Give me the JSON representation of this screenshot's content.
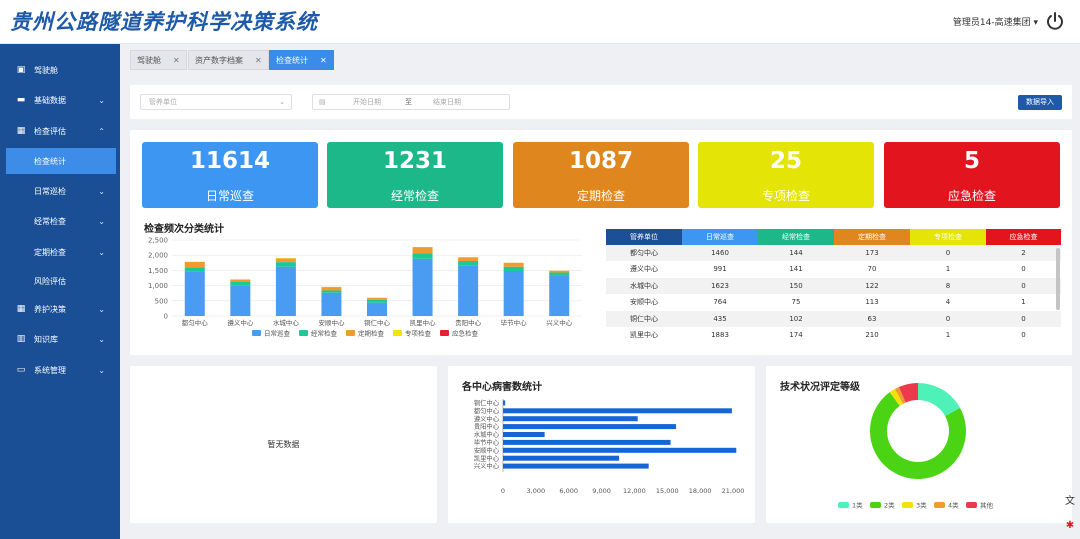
{
  "header": {
    "title": "贵州公路隧道养护科学决策系统",
    "user": "管理员14-高速集团 ▾"
  },
  "sidebar": {
    "items": [
      {
        "label": "驾驶舱",
        "icon": "dashboard-icon",
        "chev": ""
      },
      {
        "label": "基础数据",
        "icon": "database-icon",
        "chev": "⌄"
      },
      {
        "label": "检查评估",
        "icon": "grid-icon",
        "chev": "⌃"
      },
      {
        "label": "检查统计",
        "icon": "",
        "chev": ""
      },
      {
        "label": "日常巡检",
        "icon": "",
        "chev": "⌄"
      },
      {
        "label": "经常检查",
        "icon": "",
        "chev": "⌄"
      },
      {
        "label": "定期检查",
        "icon": "",
        "chev": "⌄"
      },
      {
        "label": "风险评估",
        "icon": "",
        "chev": ""
      },
      {
        "label": "养护决策",
        "icon": "grid-icon",
        "chev": "⌄"
      },
      {
        "label": "知识库",
        "icon": "book-icon",
        "chev": "⌄"
      },
      {
        "label": "系统管理",
        "icon": "monitor-icon",
        "chev": "⌄"
      }
    ]
  },
  "tabs": [
    {
      "label": "驾驶舱",
      "close": "✕"
    },
    {
      "label": "资产数字档案",
      "close": "✕"
    },
    {
      "label": "检查统计",
      "close": "✕"
    }
  ],
  "filter": {
    "unit_placeholder": "管养单位",
    "start_placeholder": "开始日期",
    "end_placeholder": "结束日期",
    "sep": "至",
    "import_label": "数据导入"
  },
  "stats": [
    {
      "value": "11614",
      "label": "日常巡查",
      "color": "#3d97f2"
    },
    {
      "value": "1231",
      "label": "经常检查",
      "color": "#1cb88a"
    },
    {
      "value": "1087",
      "label": "定期检查",
      "color": "#e0861f"
    },
    {
      "value": "25",
      "label": "专项检查",
      "color": "#e4e407"
    },
    {
      "value": "5",
      "label": "应急检查",
      "color": "#e2151f"
    }
  ],
  "freq_chart_title": "检查频次分类统计",
  "table": {
    "headers": [
      "管养单位",
      "日常巡查",
      "经常检查",
      "定期检查",
      "专项检查",
      "应急检查"
    ],
    "header_colors": [
      "#1d4f96",
      "#3d97f2",
      "#1cb88a",
      "#e0861f",
      "#e4e407",
      "#e2151f"
    ],
    "rows": [
      [
        "都匀中心",
        "1460",
        "144",
        "173",
        "0",
        "2"
      ],
      [
        "遵义中心",
        "991",
        "141",
        "70",
        "1",
        "0"
      ],
      [
        "水城中心",
        "1623",
        "150",
        "122",
        "8",
        "0"
      ],
      [
        "安顺中心",
        "764",
        "75",
        "113",
        "4",
        "1"
      ],
      [
        "铜仁中心",
        "435",
        "102",
        "63",
        "0",
        "0"
      ],
      [
        "凯里中心",
        "1883",
        "174",
        "210",
        "1",
        "0"
      ]
    ]
  },
  "no_data": "暂无数据",
  "disease_chart_title": "各中心病害数统计",
  "tech_chart_title": "技术状况评定等级",
  "chart_data": [
    {
      "type": "bar",
      "stacked": true,
      "title": "检查频次分类统计",
      "categories": [
        "都匀中心",
        "遵义中心",
        "水城中心",
        "安顺中心",
        "铜仁中心",
        "凯里中心",
        "贵阳中心",
        "毕节中心",
        "兴义中心"
      ],
      "series": [
        {
          "name": "日常巡查",
          "color": "#4a9cf2",
          "values": [
            1460,
            991,
            1623,
            764,
            435,
            1883,
            1650,
            1480,
            1330
          ]
        },
        {
          "name": "经常检查",
          "color": "#1cc996",
          "values": [
            144,
            141,
            150,
            75,
            102,
            174,
            160,
            140,
            100
          ]
        },
        {
          "name": "定期检查",
          "color": "#f39a2e",
          "values": [
            173,
            70,
            122,
            113,
            63,
            210,
            120,
            130,
            60
          ]
        },
        {
          "name": "专项检查",
          "color": "#f2e500",
          "values": [
            0,
            1,
            8,
            4,
            0,
            1,
            2,
            3,
            2
          ]
        },
        {
          "name": "应急检查",
          "color": "#e8202e",
          "values": [
            2,
            0,
            0,
            1,
            0,
            0,
            1,
            0,
            0
          ]
        }
      ],
      "yticks": [
        "0",
        "500",
        "1,000",
        "1,500",
        "2,000",
        "2,500"
      ],
      "ylim": [
        0,
        2500
      ]
    },
    {
      "type": "bar",
      "orientation": "horizontal",
      "title": "各中心病害数统计",
      "categories": [
        "铜仁中心",
        "都匀中心",
        "遵义中心",
        "贵阳中心",
        "水城中心",
        "毕节中心",
        "安顺中心",
        "凯里中心",
        "兴义中心"
      ],
      "values": [
        200,
        20900,
        12300,
        15800,
        3800,
        15300,
        21300,
        10600,
        13300
      ],
      "xticks": [
        "0",
        "3,000",
        "6,000",
        "9,000",
        "12,000",
        "15,000",
        "18,000",
        "21,000"
      ],
      "xlim": [
        0,
        21000
      ],
      "color": "#1565d8"
    },
    {
      "type": "pie",
      "donut": true,
      "title": "技术状况评定等级",
      "labels": [
        "1类",
        "2类",
        "3类",
        "4类",
        "其他"
      ],
      "values": [
        17,
        73,
        2,
        1.5,
        6.5
      ],
      "colors": [
        "#4ef1b7",
        "#4bd413",
        "#f4e10a",
        "#f39a2e",
        "#ec3a4c"
      ]
    }
  ]
}
